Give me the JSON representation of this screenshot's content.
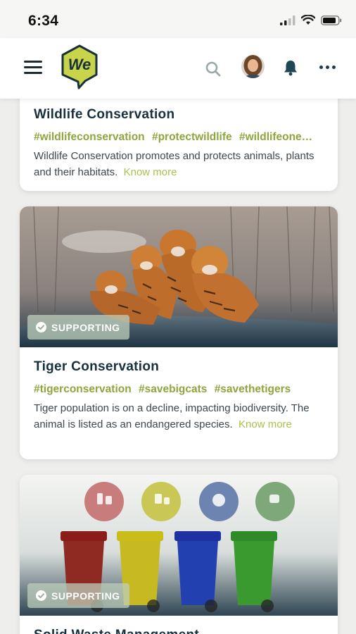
{
  "status_bar": {
    "time": "6:34"
  },
  "header": {
    "logo_text": "We"
  },
  "cards": [
    {
      "title": "Wildlife Conservation",
      "tags": [
        "#wildlifeconservation",
        "#protectwildlife",
        "#wildlifeone…"
      ],
      "description": "Wildlife Conservation promotes and protects animals, plants and their habitats.",
      "link": "Know more"
    },
    {
      "badge": "SUPPORTING",
      "title": "Tiger Conservation",
      "tags": [
        "#tigerconservation",
        "#savebigcats",
        "#savethetigers"
      ],
      "description": "Tiger population is on a decline, impacting biodiversity. The animal is listed as an endangered species.",
      "link": "Know more"
    },
    {
      "badge": "SUPPORTING",
      "title": "Solid Waste Management"
    }
  ],
  "colors": {
    "accent": "#a9c24b",
    "tag": "#8ea63c",
    "title": "#17303e",
    "logo": "#c8d44a"
  }
}
